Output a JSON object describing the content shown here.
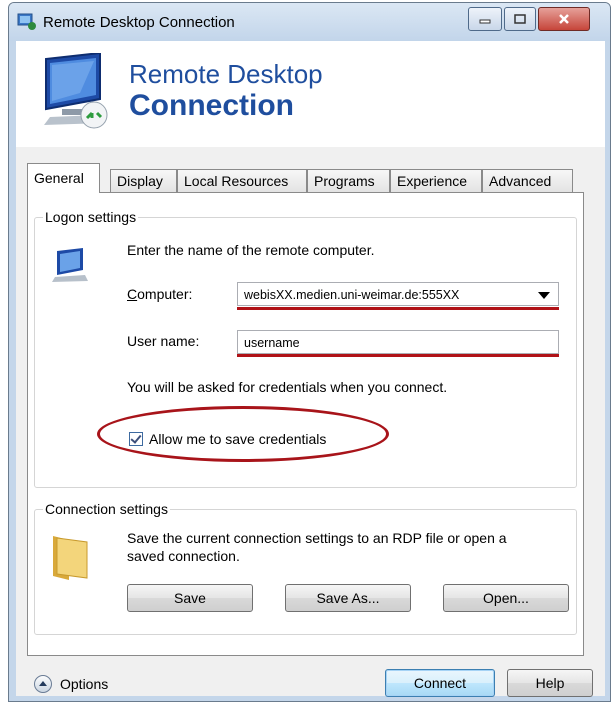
{
  "window": {
    "title": "Remote Desktop Connection"
  },
  "banner": {
    "line1": "Remote Desktop",
    "line2": "Connection"
  },
  "tabs": [
    {
      "label": "General",
      "active": true
    },
    {
      "label": "Display"
    },
    {
      "label": "Local Resources"
    },
    {
      "label": "Programs"
    },
    {
      "label": "Experience"
    },
    {
      "label": "Advanced"
    }
  ],
  "logon": {
    "group_label": "Logon settings",
    "instruction": "Enter the name of the remote computer.",
    "computer_label": "Computer:",
    "computer_value": "webisXX.medien.uni-weimar.de:555XX",
    "username_label": "User name:",
    "username_value": "username",
    "credentials_note": "You will be asked for credentials when you connect.",
    "save_credentials_label": "Allow me to save credentials",
    "save_credentials_checked": true
  },
  "connection": {
    "group_label": "Connection settings",
    "description_line1": "Save the current connection settings to an RDP file or open a",
    "description_line2": "saved connection.",
    "save_label": "Save",
    "save_as_label": "Save As...",
    "open_label": "Open..."
  },
  "footer": {
    "options_label": "Options",
    "connect_label": "Connect",
    "help_label": "Help"
  },
  "colors": {
    "banner_text": "#1f4e9e",
    "annotation_red": "#a8141a"
  },
  "icons": [
    "app-icon",
    "banner-computer-icon",
    "computer-icon",
    "folder-icon",
    "options-chevron-icon",
    "minimize-icon",
    "maximize-icon",
    "close-icon",
    "dropdown-arrow-icon"
  ]
}
